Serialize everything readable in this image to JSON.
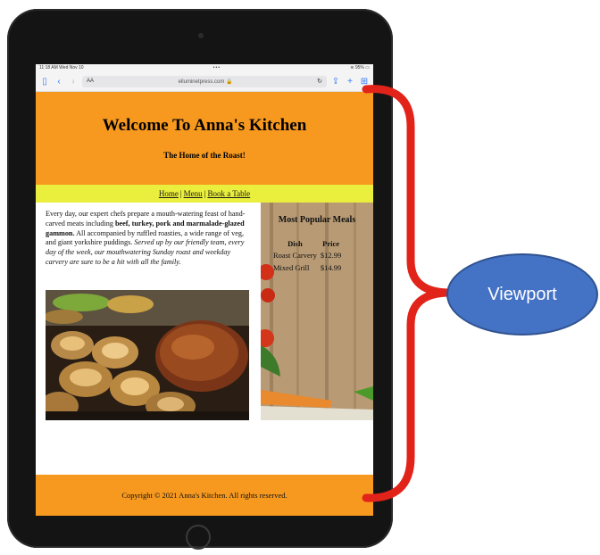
{
  "status_bar": {
    "time": "11:18 AM",
    "date": "Wed Nov 10",
    "dots": "•••",
    "battery": "95%"
  },
  "browser": {
    "text_size_label": "AA",
    "url": "elluminetpress.com",
    "lock_symbol": "🔒",
    "reload_symbol": "↻"
  },
  "header": {
    "title": "Welcome To Anna's Kitchen",
    "subtitle": "The Home of the Roast!"
  },
  "nav": {
    "items": [
      "Home",
      "Menu",
      "Book a Table"
    ],
    "separator": "|"
  },
  "intro": {
    "text1": "Every day, our expert chefs prepare a mouth-watering feast of hand-carved meats including ",
    "bold": "beef, turkey, pork and marmalade-glazed gammon.",
    "text2": " All accompanied by ruffled roasties, a wide range of veg, and giant yorkshire puddings. ",
    "italic": "Served up by our friendly team, every day of the week, our mouthwatering Sunday roast and weekday carvery are sure to be a hit with all the family."
  },
  "popular": {
    "title": "Most Popular Meals",
    "headers": [
      "Dish",
      "Price"
    ],
    "rows": [
      {
        "dish": "Roast Carvery",
        "price": "$12.99"
      },
      {
        "dish": "Mixed Grill",
        "price": "$14.99"
      }
    ]
  },
  "footer": {
    "text": "Copyright © 2021 Anna's Kitchen. All rights reserved."
  },
  "annotation": {
    "label": "Viewport",
    "brace_color": "#e2231a",
    "bubble_color": "#4472c4"
  }
}
